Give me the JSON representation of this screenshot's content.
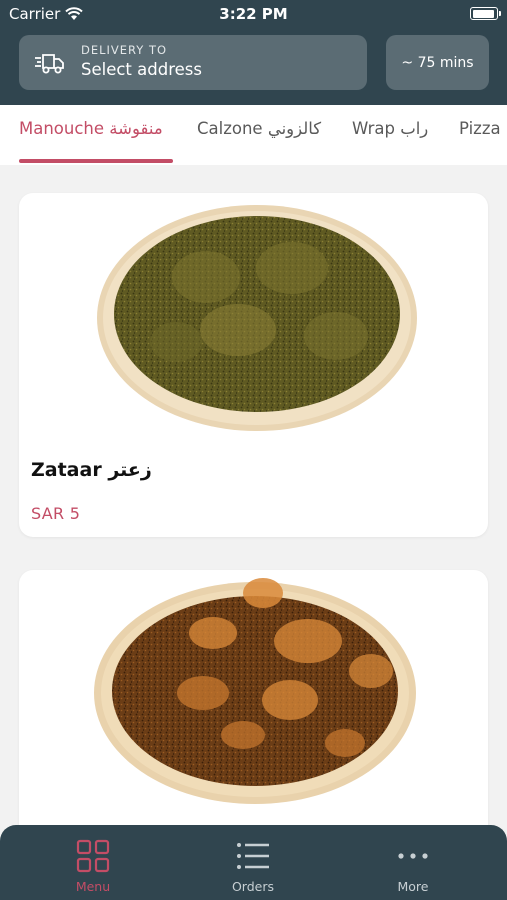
{
  "status_bar": {
    "carrier": "Carrier",
    "time": "3:22 PM"
  },
  "header": {
    "delivery_label": "DELIVERY TO",
    "delivery_value": "Select address",
    "eta": "~ 75 mins"
  },
  "tabs": [
    {
      "label": "Manouche منقوشة",
      "active": true
    },
    {
      "label": "Calzone كالزوني",
      "active": false
    },
    {
      "label": "Wrap راب",
      "active": false
    },
    {
      "label": "Pizza",
      "active": false
    }
  ],
  "menu_items": [
    {
      "name": "Zataar زعتر",
      "price": "SAR 5"
    }
  ],
  "bottom_nav": [
    {
      "label": "Menu",
      "icon": "grid-icon",
      "active": true
    },
    {
      "label": "Orders",
      "icon": "list-icon",
      "active": false
    },
    {
      "label": "More",
      "icon": "more-dots-icon",
      "active": false
    }
  ],
  "colors": {
    "header_bg": "#30454f",
    "accent": "#c34d66",
    "box_bg": "#5b6c74"
  }
}
